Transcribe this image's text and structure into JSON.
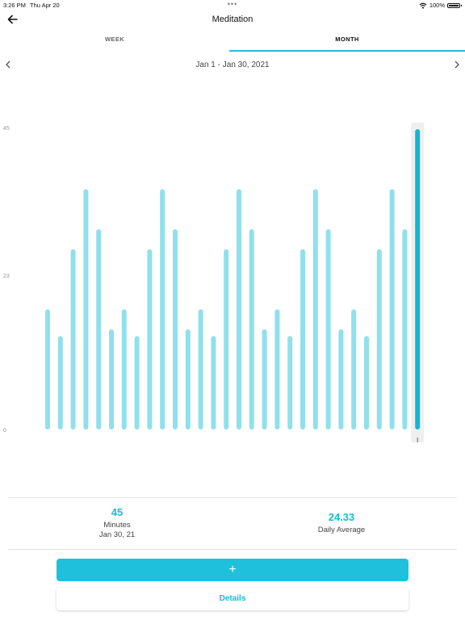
{
  "status_bar": {
    "time": "3:26 PM",
    "date": "Thu Apr 20",
    "battery": "100%"
  },
  "header": {
    "title": "Meditation"
  },
  "tabs": [
    {
      "label": "WEEK"
    },
    {
      "label": "MONTH"
    }
  ],
  "date_range": "Jan 1 - Jan 30, 2021",
  "colors": {
    "accent": "#1ec0dc",
    "bar": "#8fe0ec",
    "selected_bar": "#14b6d2"
  },
  "chart_data": {
    "type": "bar",
    "y_ticks": [
      "45",
      "23",
      "0"
    ],
    "ylim": [
      0,
      45
    ],
    "values": [
      18,
      14,
      27,
      36,
      30,
      15,
      18,
      14,
      27,
      36,
      30,
      15,
      18,
      14,
      27,
      36,
      30,
      15,
      18,
      14,
      27,
      36,
      30,
      15,
      18,
      14,
      27,
      36,
      30,
      45
    ],
    "selected_index": 29
  },
  "summary": {
    "selected_value": "45",
    "selected_unit": "Minutes",
    "selected_date": "Jan 30, 21",
    "average_value": "24.33",
    "average_label": "Daily Average"
  },
  "actions": {
    "add_label": "+",
    "details_label": "Details"
  }
}
